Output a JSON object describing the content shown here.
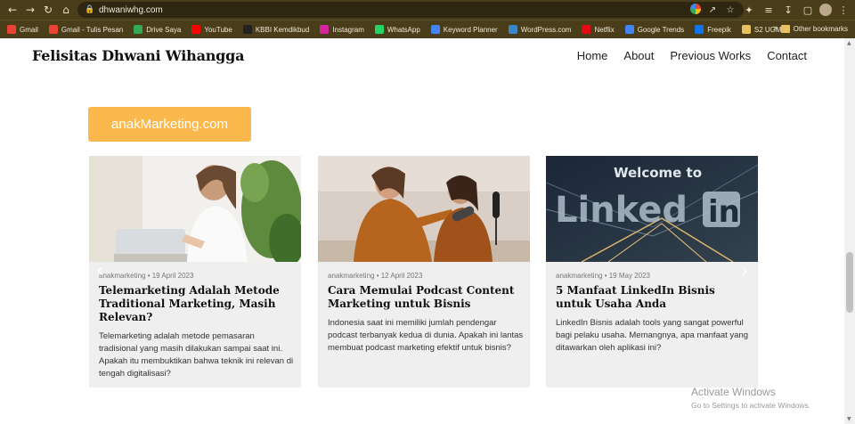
{
  "browser": {
    "url": "dhwaniwhg.com",
    "bookmarks": [
      {
        "label": "Gmail",
        "color": "#ea4335"
      },
      {
        "label": "Gmail - Tulis Pesan",
        "color": "#ea4335"
      },
      {
        "label": "Drive Saya",
        "color": "#34a853"
      },
      {
        "label": "YouTube",
        "color": "#ff0000"
      },
      {
        "label": "KBBI Kemdikbud",
        "color": "#222222"
      },
      {
        "label": "Instagram",
        "color": "#d6249f"
      },
      {
        "label": "WhatsApp",
        "color": "#25d366"
      },
      {
        "label": "Keyword Planner",
        "color": "#4285f4"
      },
      {
        "label": "WordPress.com",
        "color": "#3a86c8"
      },
      {
        "label": "Netflix",
        "color": "#e50914"
      },
      {
        "label": "Google Trends",
        "color": "#4285f4"
      },
      {
        "label": "Freepik",
        "color": "#1273eb"
      },
      {
        "label": "S2 UGM",
        "color": "#e8c060"
      }
    ],
    "more_label": "»",
    "other_bookmarks": "Other bookmarks"
  },
  "site": {
    "title": "Felisitas Dhwani Wihangga",
    "nav": [
      "Home",
      "About",
      "Previous Works",
      "Contact"
    ],
    "category_button": "anakMarketing.com",
    "accent": "#fbb84c"
  },
  "posts": [
    {
      "meta": "anakmarketing • 19 April 2023",
      "title": "Telemarketing Adalah Metode Traditional Marketing, Masih Relevan?",
      "excerpt": "Telemarketing adalah metode pemasaran tradisional yang masih dilakukan sampai saat ini. Apakah itu membuktikan bahwa teknik ini relevan di tengah digitalisasi?"
    },
    {
      "meta": "anakmarketing • 12 April 2023",
      "title": "Cara Memulai Podcast Content Marketing untuk Bisnis",
      "excerpt": "Indonesia saat ini memiliki jumlah pendengar podcast terbanyak kedua di dunia. Apakah ini lantas membuat podcast marketing efektif untuk bisnis?"
    },
    {
      "meta": "anakmarketing • 19 May 2023",
      "title": "5 Manfaat LinkedIn Bisnis untuk Usaha Anda",
      "excerpt": "LinkedIn Bisnis adalah tools yang sangat powerful bagi pelaku usaha. Memangnya, apa manfaat yang ditawarkan oleh aplikasi ini?",
      "image_text": "Welcome to"
    }
  ],
  "watermark": {
    "line1": "Activate Windows",
    "line2": "Go to Settings to activate Windows."
  }
}
